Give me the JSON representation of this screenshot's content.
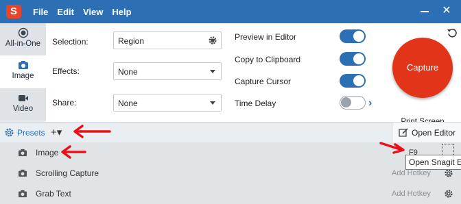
{
  "menu": {
    "items": [
      "File",
      "Edit",
      "View",
      "Help"
    ]
  },
  "modes": {
    "all_in_one": "All-in-One",
    "image": "Image",
    "video": "Video"
  },
  "settings": {
    "selection_label": "Selection:",
    "selection_value": "Region",
    "effects_label": "Effects:",
    "effects_value": "None",
    "share_label": "Share:",
    "share_value": "None"
  },
  "options": [
    {
      "label": "Preview in Editor",
      "on": true
    },
    {
      "label": "Copy to Clipboard",
      "on": true
    },
    {
      "label": "Capture Cursor",
      "on": true
    },
    {
      "label": "Time Delay",
      "on": false
    }
  ],
  "capture": {
    "button_label": "Capture",
    "hotkey_label": "Print Screen"
  },
  "presets": {
    "label": "Presets",
    "add_symbol": "+▾",
    "open_editor_label": "Open Editor"
  },
  "preset_list": [
    {
      "name": "Image",
      "hotkey": "F9"
    },
    {
      "name": "Scrolling Capture",
      "hotkey": "Add Hotkey"
    },
    {
      "name": "Grab Text",
      "hotkey": "Add Hotkey"
    }
  ],
  "tooltip": "Open Snagit Editor",
  "colors": {
    "title_bar": "#2d6fb4",
    "capture": "#e23418",
    "annotation_arrow": "#e8101a",
    "accent": "#2d6fb4"
  }
}
